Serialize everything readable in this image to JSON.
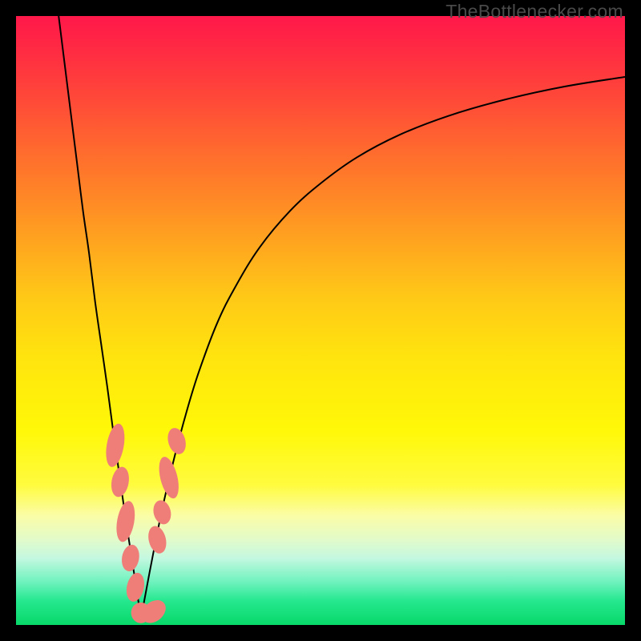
{
  "watermark": {
    "text": "TheBottlenecker.com"
  },
  "chart_data": {
    "type": "line",
    "title": "",
    "xlabel": "",
    "ylabel": "",
    "xlim": [
      0,
      100
    ],
    "ylim": [
      0,
      100
    ],
    "x_optimum": 20.5,
    "colors": {
      "gradient_top": "#ff184a",
      "gradient_bottom": "#08d869",
      "curve": "#000000",
      "marker": "#ef7e78"
    },
    "series": [
      {
        "name": "bottleneck-curve-left",
        "x": [
          7,
          8,
          9,
          10,
          11,
          12,
          13,
          14,
          15,
          16,
          17,
          18,
          19,
          20,
          20.5
        ],
        "y": [
          100,
          92,
          84,
          76,
          68,
          61,
          53,
          46,
          39,
          31.5,
          24.5,
          17.5,
          11,
          4.5,
          1
        ]
      },
      {
        "name": "bottleneck-curve-right",
        "x": [
          20.5,
          22,
          24,
          26,
          28,
          30,
          33,
          36,
          40,
          45,
          50,
          56,
          63,
          71,
          80,
          90,
          100
        ],
        "y": [
          1,
          9,
          19,
          27.5,
          35,
          41.5,
          49.5,
          55.5,
          62,
          68,
          72.5,
          76.8,
          80.5,
          83.6,
          86.2,
          88.4,
          90
        ]
      }
    ],
    "markers": [
      {
        "name": "left-marker-1",
        "x": 16.3,
        "y": 29.5,
        "rx": 1.4,
        "ry": 3.6,
        "rot": 10
      },
      {
        "name": "left-marker-2",
        "x": 17.1,
        "y": 23.5,
        "rx": 1.4,
        "ry": 2.5,
        "rot": 10
      },
      {
        "name": "left-marker-3",
        "x": 18.0,
        "y": 17.0,
        "rx": 1.4,
        "ry": 3.4,
        "rot": 10
      },
      {
        "name": "left-marker-4",
        "x": 18.8,
        "y": 11.0,
        "rx": 1.4,
        "ry": 2.2,
        "rot": 10
      },
      {
        "name": "left-marker-5",
        "x": 19.6,
        "y": 6.2,
        "rx": 1.4,
        "ry": 2.4,
        "rot": 12
      },
      {
        "name": "bottom-marker-1",
        "x": 20.5,
        "y": 2.0,
        "rx": 1.6,
        "ry": 1.7,
        "rot": 0
      },
      {
        "name": "bottom-marker-2",
        "x": 22.6,
        "y": 2.2,
        "rx": 2.2,
        "ry": 1.6,
        "rot": -40
      },
      {
        "name": "right-marker-1",
        "x": 23.2,
        "y": 14.0,
        "rx": 1.4,
        "ry": 2.3,
        "rot": -14
      },
      {
        "name": "right-marker-2",
        "x": 24.0,
        "y": 18.5,
        "rx": 1.4,
        "ry": 2.0,
        "rot": -14
      },
      {
        "name": "right-marker-3",
        "x": 25.1,
        "y": 24.2,
        "rx": 1.4,
        "ry": 3.5,
        "rot": -14
      },
      {
        "name": "right-marker-4",
        "x": 26.4,
        "y": 30.2,
        "rx": 1.4,
        "ry": 2.2,
        "rot": -16
      }
    ]
  }
}
